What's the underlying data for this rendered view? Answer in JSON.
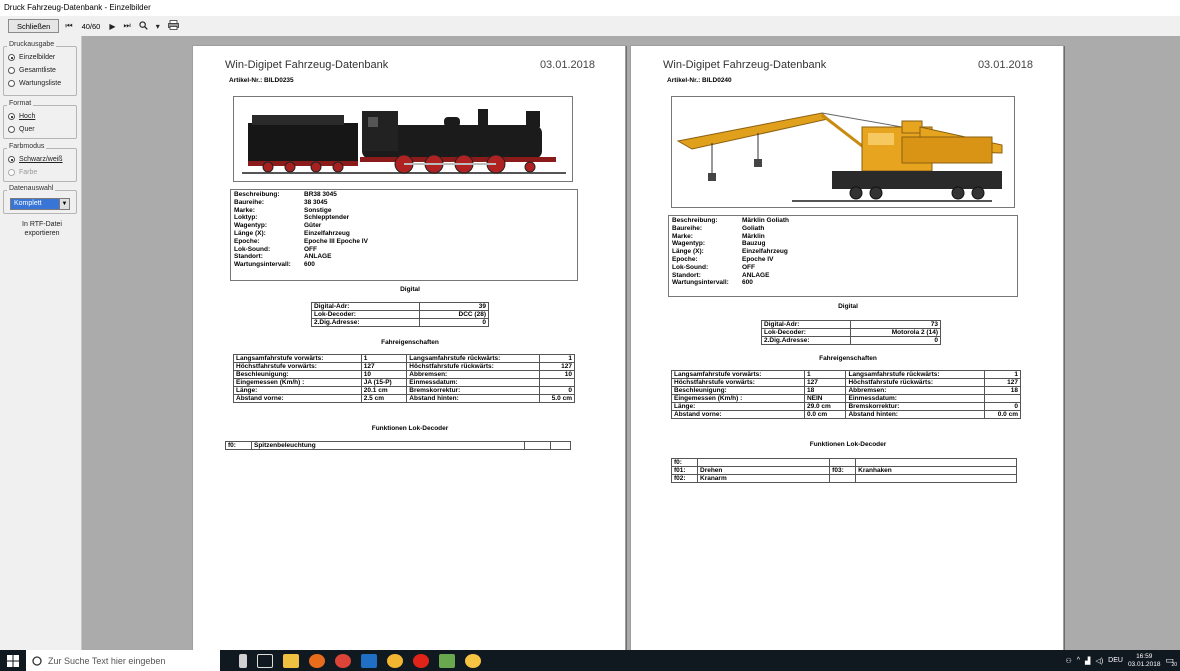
{
  "window": {
    "title": "Druck Fahrzeug-Datenbank - Einzelbilder"
  },
  "toolbar": {
    "close_label": "Schließen",
    "page_display": "40/60",
    "first_glyph": "⏮",
    "prev_glyph": "◀",
    "next_glyph": "▶",
    "last_glyph": "⏭",
    "zoom_glyph": "🔍",
    "dropdown_glyph": "▾",
    "print_icon": "printer-icon"
  },
  "sidebar": {
    "print_group": {
      "legend": "Druckausgabe",
      "options": [
        "Einzelbilder",
        "Gesamtliste",
        "Wartungsliste"
      ],
      "selected": 0
    },
    "format_group": {
      "legend": "Format",
      "options": [
        "Hoch",
        "Quer"
      ],
      "selected": 0
    },
    "color_group": {
      "legend": "Farbmodus",
      "options": [
        "Schwarz/weiß",
        "Farbe"
      ],
      "selected": 0
    },
    "data_group": {
      "legend": "Datenauswahl",
      "value": "Komplett"
    },
    "export_label_1": "In RTF-Datei",
    "export_label_2": "exportieren"
  },
  "pages": [
    {
      "header": "Win-Digipet Fahrzeug-Datenbank",
      "date": "03.01.2018",
      "article": "Artikel-Nr.: BILD0235",
      "image_icon": "steam-locomotive-image",
      "desc": [
        [
          "Beschreibung:",
          "BR38 3045"
        ],
        [
          "Baureihe:",
          "38 3045"
        ],
        [
          "Marke:",
          "Sonstige"
        ],
        [
          "Loktyp:",
          "Schlepptender"
        ],
        [
          "Wagentyp:",
          "Güter"
        ],
        [
          "Länge (X):",
          "Einzelfahrzeug"
        ],
        [
          "Epoche:",
          "Epoche III Epoche IV"
        ],
        [
          "Lok-Sound:",
          "OFF"
        ],
        [
          "Standort:",
          "ANLAGE"
        ],
        [
          "Wartungsintervall:",
          "600"
        ]
      ],
      "digital_title": "Digital",
      "digital": [
        [
          "Digital-Adr:",
          "39"
        ],
        [
          "Lok-Decoder:",
          "DCC (28)"
        ],
        [
          "2.Dig.Adresse:",
          "0"
        ]
      ],
      "fahr_title": "Fahreigenschaften",
      "fahr": [
        [
          "Langsamfahrstufe vorwärts:",
          "1",
          "Langsamfahrstufe rückwärts:",
          "1"
        ],
        [
          "Höchstfahrstufe vorwärts:",
          "127",
          "Höchstfahrstufe rückwärts:",
          "127"
        ],
        [
          "Beschleunigung:",
          "10",
          "Abbremsen:",
          "10"
        ],
        [
          "Eingemessen (Km/h) :",
          "JA (15-P)",
          "Einmessdatum:",
          ""
        ],
        [
          "Länge:",
          "20.1 cm",
          "Bremskorrektur:",
          "0"
        ],
        [
          "Abstand vorne:",
          "2.5 cm",
          "Abstand hinten:",
          "5.0 cm"
        ]
      ],
      "func_title": "Funktionen Lok-Decoder",
      "func": [
        [
          "f0:",
          "Spitzenbeleuchtung",
          "",
          ""
        ]
      ]
    },
    {
      "header": "Win-Digipet Fahrzeug-Datenbank",
      "date": "03.01.2018",
      "article": "Artikel-Nr.: BILD0240",
      "image_icon": "crane-car-image",
      "desc": [
        [
          "Beschreibung:",
          "Märklin Goliath"
        ],
        [
          "Baureihe:",
          "Goliath"
        ],
        [
          "Marke:",
          "Märklin"
        ],
        [
          "Wagentyp:",
          "Bauzug"
        ],
        [
          "Länge (X):",
          "Einzelfahrzeug"
        ],
        [
          "Epoche:",
          "Epoche IV"
        ],
        [
          "Lok-Sound:",
          "OFF"
        ],
        [
          "Standort:",
          "ANLAGE"
        ],
        [
          "Wartungsintervall:",
          "600"
        ]
      ],
      "digital_title": "Digital",
      "digital": [
        [
          "Digital-Adr:",
          "73"
        ],
        [
          "Lok-Decoder:",
          "Motorola 2 (14)"
        ],
        [
          "2.Dig.Adresse:",
          "0"
        ]
      ],
      "fahr_title": "Fahreigenschaften",
      "fahr": [
        [
          "Langsamfahrstufe vorwärts:",
          "1",
          "Langsamfahrstufe rückwärts:",
          "1"
        ],
        [
          "Höchstfahrstufe vorwärts:",
          "127",
          "Höchstfahrstufe rückwärts:",
          "127"
        ],
        [
          "Beschleunigung:",
          "18",
          "Abbremsen:",
          "18"
        ],
        [
          "Eingemessen (Km/h) :",
          "NEIN",
          "Einmessdatum:",
          ""
        ],
        [
          "Länge:",
          "29.0 cm",
          "Bremskorrektur:",
          "0"
        ],
        [
          "Abstand vorne:",
          "0.0 cm",
          "Abstand hinten:",
          "0.0 cm"
        ]
      ],
      "func_title": "Funktionen Lok-Decoder",
      "func": [
        [
          "f0:",
          "",
          "",
          ""
        ],
        [
          "f01:",
          "Drehen",
          "f03:",
          "Kranhaken"
        ],
        [
          "f02:",
          "Kranarm",
          "",
          ""
        ]
      ]
    }
  ],
  "taskbar": {
    "search_placeholder": "Zur Suche Text hier eingeben",
    "language": "DEU",
    "time": "16:59",
    "date": "03.01.2018",
    "notification_count": "20",
    "icons": [
      "microphone-icon",
      "task-view-icon",
      "file-explorer-icon",
      "firefox-icon",
      "chrome-icon",
      "outlook-icon",
      "app-icon",
      "opera-icon",
      "windigipet-icon",
      "emoji-icon"
    ]
  }
}
